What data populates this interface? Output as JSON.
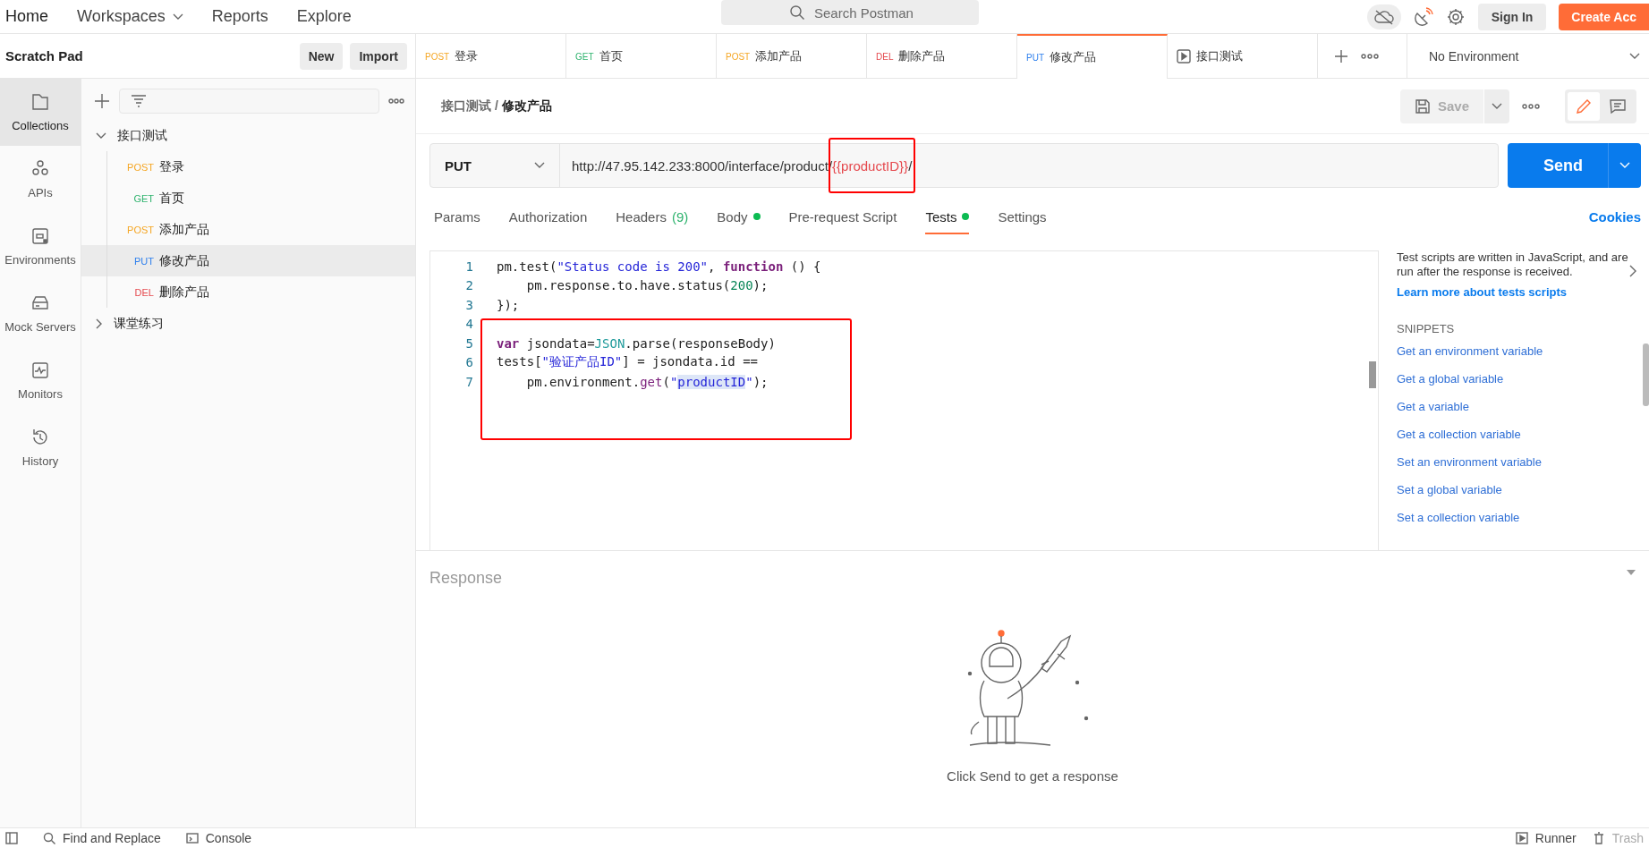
{
  "top_nav": {
    "items": [
      {
        "label": "Home",
        "dropdown": false
      },
      {
        "label": "Workspaces",
        "dropdown": true
      },
      {
        "label": "Reports",
        "dropdown": false
      },
      {
        "label": "Explore",
        "dropdown": false
      }
    ],
    "search": {
      "placeholder": "Search Postman"
    },
    "sign_in": "Sign In",
    "create_account": "Create Acc"
  },
  "scratch_pad": {
    "title": "Scratch Pad",
    "buttons": [
      "New",
      "Import"
    ]
  },
  "request_tabs": [
    {
      "kind": "request",
      "method": "POST",
      "color": "#f5a623",
      "name": "登录",
      "selected": false
    },
    {
      "kind": "request",
      "method": "GET",
      "color": "#2fb36e",
      "name": "首页",
      "selected": false
    },
    {
      "kind": "request",
      "method": "POST",
      "color": "#f5a623",
      "name": "添加产品",
      "selected": false
    },
    {
      "kind": "request",
      "method": "DEL",
      "color": "#e5484d",
      "name": "删除产品",
      "selected": false
    },
    {
      "kind": "request",
      "method": "PUT",
      "color": "#2f80ed",
      "name": "修改产品",
      "selected": true
    },
    {
      "kind": "runner",
      "name": "接口测试",
      "selected": false
    }
  ],
  "environment": {
    "value": "No Environment"
  },
  "rail": [
    {
      "label": "Collections",
      "selected": true
    },
    {
      "label": "APIs",
      "selected": false
    },
    {
      "label": "Environments",
      "selected": false
    },
    {
      "label": "Mock Servers",
      "selected": false
    },
    {
      "label": "Monitors",
      "selected": false
    },
    {
      "label": "History",
      "selected": false
    }
  ],
  "collections": [
    {
      "name": "接口测试",
      "expanded": true,
      "children": [
        {
          "method": "POST",
          "color": "#f5a623",
          "name": "登录",
          "selected": false
        },
        {
          "method": "GET",
          "color": "#2fb36e",
          "name": "首页",
          "selected": false
        },
        {
          "method": "POST",
          "color": "#f5a623",
          "name": "添加产品",
          "selected": false
        },
        {
          "method": "PUT",
          "color": "#2f80ed",
          "name": "修改产品",
          "selected": true
        },
        {
          "method": "DEL",
          "color": "#e5484d",
          "name": "删除产品",
          "selected": false
        }
      ]
    },
    {
      "name": "课堂练习",
      "expanded": false
    }
  ],
  "breadcrumb": {
    "parent": "接口测试",
    "separator": "/",
    "current": "修改产品"
  },
  "save": {
    "label": "Save",
    "disabled": true
  },
  "request": {
    "method": "PUT",
    "url_base": "http://47.95.142.233:8000/interface/product/",
    "url_variable": "{{productID}}",
    "url_tail": "/",
    "url_variable_boxed": true,
    "send": "Send"
  },
  "request_sections": [
    {
      "label": "Params",
      "selected": false,
      "dot": false
    },
    {
      "label": "Authorization",
      "selected": false,
      "dot": false
    },
    {
      "label": "Headers",
      "count": "(9)",
      "selected": false,
      "dot": false
    },
    {
      "label": "Body",
      "selected": false,
      "dot": true
    },
    {
      "label": "Pre-request Script",
      "selected": false,
      "dot": false
    },
    {
      "label": "Tests",
      "selected": true,
      "dot": true
    },
    {
      "label": "Settings",
      "selected": false,
      "dot": false
    }
  ],
  "cookies": "Cookies",
  "editor": {
    "lines": [
      {
        "number": "1",
        "boxed": false,
        "tokens": [
          {
            "t": "pm.test(",
            "kind": "plain"
          },
          {
            "t": "\"Status code is 200\"",
            "kind": "string"
          },
          {
            "t": ", ",
            "kind": "plain"
          },
          {
            "t": "function",
            "kind": "keyword"
          },
          {
            "t": " () {",
            "kind": "plain"
          }
        ]
      },
      {
        "number": "2",
        "boxed": false,
        "tokens": [
          {
            "t": "    pm.response.to.have.status(",
            "kind": "plain"
          },
          {
            "t": "200",
            "kind": "number"
          },
          {
            "t": ");",
            "kind": "plain"
          }
        ]
      },
      {
        "number": "3",
        "boxed": false,
        "tokens": [
          {
            "t": "});",
            "kind": "plain"
          }
        ]
      },
      {
        "number": "4",
        "boxed": true
      },
      {
        "number": "5",
        "boxed": true,
        "tokens": [
          {
            "t": "var",
            "kind": "keyword"
          },
          {
            "t": " jsondata=",
            "kind": "plain"
          },
          {
            "t": "JSON",
            "kind": "global"
          },
          {
            "t": ".parse(responseBody)",
            "kind": "plain"
          }
        ]
      },
      {
        "number": "6",
        "boxed": true,
        "tokens": [
          {
            "t": "tests[",
            "kind": "plain"
          },
          {
            "t": "\"验证产品ID\"",
            "kind": "string"
          },
          {
            "t": "] = jsondata.id ==",
            "kind": "plain"
          }
        ]
      },
      {
        "number": "7",
        "boxed": true,
        "tokens": [
          {
            "t": "    pm.environment.",
            "kind": "plain"
          },
          {
            "t": "get",
            "kind": "method"
          },
          {
            "t": "(",
            "kind": "plain"
          },
          {
            "t": "\"",
            "kind": "string"
          },
          {
            "t": "productID",
            "kind": "match"
          },
          {
            "t": "\"",
            "kind": "string"
          },
          {
            "t": ");",
            "kind": "plain"
          }
        ]
      }
    ]
  },
  "help": {
    "description": "Test scripts are written in JavaScript, and are run after the response is received.",
    "link": "Learn more about tests scripts",
    "snippets_heading": "SNIPPETS",
    "snippets": [
      "Get an environment variable",
      "Get a global variable",
      "Get a variable",
      "Get a collection variable",
      "Set an environment variable",
      "Set a global variable",
      "Set a collection variable"
    ]
  },
  "response": {
    "heading": "Response",
    "empty_message": "Click Send to get a response"
  },
  "status_bar": {
    "left": [
      {
        "label": "Find and Replace"
      },
      {
        "label": "Console"
      }
    ],
    "right": [
      {
        "label": "Runner",
        "disabled": false
      },
      {
        "label": "Trash",
        "disabled": true
      }
    ]
  }
}
